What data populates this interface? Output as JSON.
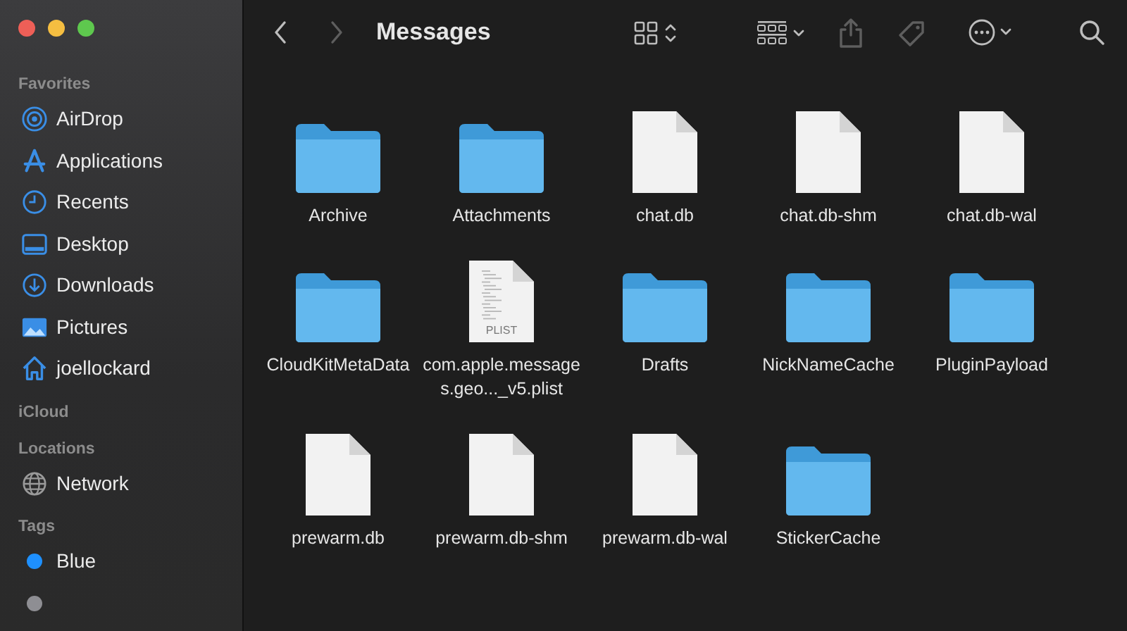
{
  "window": {
    "title": "Messages"
  },
  "sidebar": {
    "sections": [
      {
        "title": "Favorites",
        "items": [
          {
            "label": "AirDrop",
            "kind": "airdrop"
          },
          {
            "label": "Applications",
            "kind": "applications"
          },
          {
            "label": "Recents",
            "kind": "recents"
          },
          {
            "label": "Desktop",
            "kind": "desktop"
          },
          {
            "label": "Downloads",
            "kind": "downloads"
          },
          {
            "label": "Pictures",
            "kind": "pictures"
          },
          {
            "label": "joellockard",
            "kind": "home"
          }
        ]
      },
      {
        "title": "iCloud"
      },
      {
        "title": "Locations",
        "items": [
          {
            "label": "Network",
            "kind": "network"
          }
        ]
      },
      {
        "title": "Tags",
        "items": [
          {
            "label": "Blue",
            "kind": "tag",
            "color": "#1e90ff"
          },
          {
            "kind": "tag",
            "color": "#8e8e93"
          }
        ]
      }
    ]
  },
  "files": [
    {
      "name": "Archive",
      "kind": "folder"
    },
    {
      "name": "Attachments",
      "kind": "folder"
    },
    {
      "name": "chat.db",
      "kind": "document"
    },
    {
      "name": "chat.db-shm",
      "kind": "document"
    },
    {
      "name": "chat.db-wal",
      "kind": "document"
    },
    {
      "name": "CloudKitMetaData",
      "kind": "folder"
    },
    {
      "name": "com.apple.messages.geo..._v5.plist",
      "kind": "plist",
      "badge": "PLIST"
    },
    {
      "name": "Drafts",
      "kind": "folder"
    },
    {
      "name": "NickNameCache",
      "kind": "folder"
    },
    {
      "name": "PluginPayload",
      "kind": "folder"
    },
    {
      "name": "prewarm.db",
      "kind": "document"
    },
    {
      "name": "prewarm.db-shm",
      "kind": "document"
    },
    {
      "name": "prewarm.db-wal",
      "kind": "document"
    },
    {
      "name": "StickerCache",
      "kind": "folder"
    }
  ]
}
